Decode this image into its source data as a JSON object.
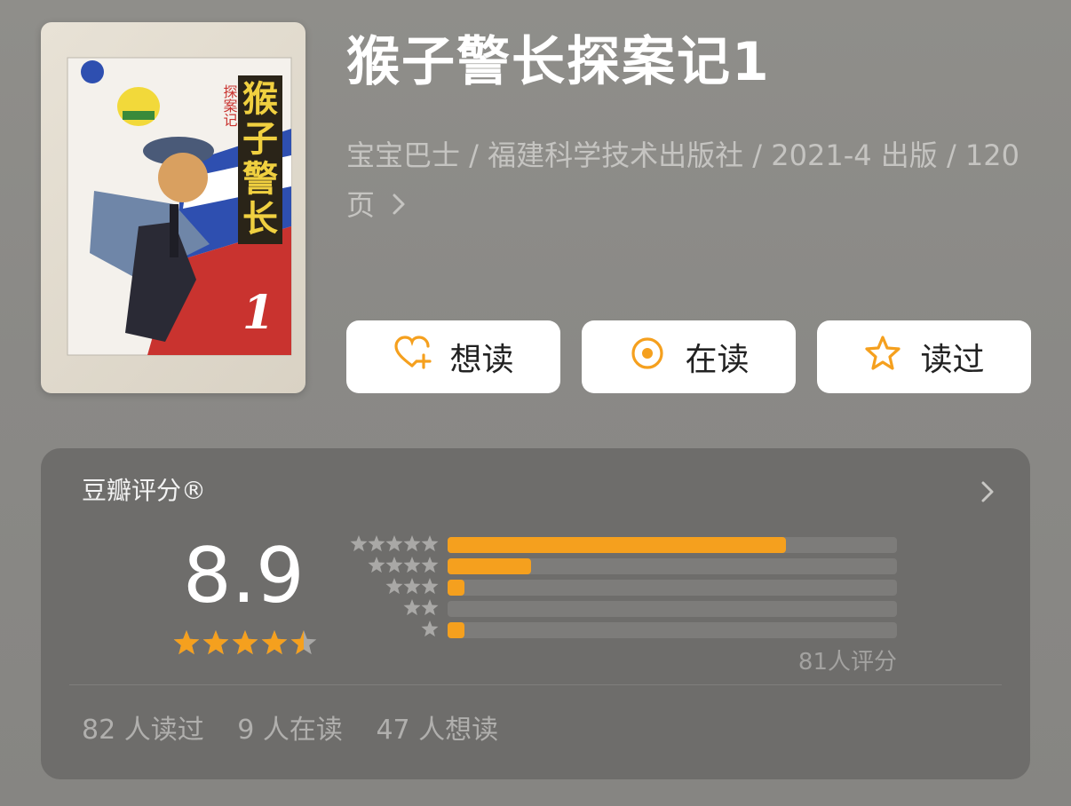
{
  "book": {
    "title": "猴子警长探案记1",
    "meta": "宝宝巴士 / 福建科学技术出版社 / 2021-4 出版 / 120 页",
    "cover": {
      "title_chars": [
        "猴",
        "子",
        "警",
        "长"
      ],
      "subtitle": "探案记",
      "number": "1"
    }
  },
  "actions": {
    "want": {
      "label": "想读",
      "icon": "heart-plus-icon"
    },
    "reading": {
      "label": "在读",
      "icon": "target-circle-icon"
    },
    "read": {
      "label": "读过",
      "icon": "star-outline-icon"
    }
  },
  "rating": {
    "title": "豆瓣评分®",
    "score": "8.9",
    "stars_value": 4.5,
    "distribution": [
      {
        "stars": 5,
        "fraction": 0.753
      },
      {
        "stars": 4,
        "fraction": 0.185
      },
      {
        "stars": 3,
        "fraction": 0.037
      },
      {
        "stars": 2,
        "fraction": 0.0
      },
      {
        "stars": 1,
        "fraction": 0.037
      }
    ],
    "count_text": "81人评分"
  },
  "stats": {
    "read": "82 人读过",
    "reading": "9 人在读",
    "want": "47 人想读"
  },
  "colors": {
    "accent": "#f5a01e",
    "panel": "#6e6d6b",
    "track": "#7d7c7a",
    "button_bg": "#ffffff"
  }
}
